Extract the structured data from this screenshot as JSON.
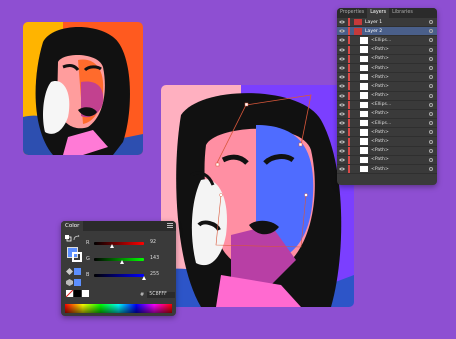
{
  "layers_panel": {
    "tabs": [
      "Properties",
      "Layers",
      "Libraries"
    ],
    "active_tab": "Layers",
    "layers": [
      {
        "name": "Layer 1",
        "kind": "layer",
        "expanded": false
      },
      {
        "name": "Layer 2",
        "kind": "layer",
        "expanded": true,
        "selected": true
      }
    ],
    "items": [
      {
        "name": "<Ellips..."
      },
      {
        "name": "<Path>"
      },
      {
        "name": "<Path>"
      },
      {
        "name": "<Path>"
      },
      {
        "name": "<Path>"
      },
      {
        "name": "<Path>"
      },
      {
        "name": "<Path>"
      },
      {
        "name": "<Ellips..."
      },
      {
        "name": "<Path>"
      },
      {
        "name": "<Ellips..."
      },
      {
        "name": "<Path>"
      },
      {
        "name": "<Path>"
      },
      {
        "name": "<Path>"
      },
      {
        "name": "<Path>"
      },
      {
        "name": "<Path>"
      }
    ]
  },
  "color_panel": {
    "tab": "Color",
    "channels": [
      {
        "label": "R",
        "value": "92",
        "level": 0.36,
        "gradient": [
          "#000000",
          "#ff0000"
        ]
      },
      {
        "label": "G",
        "value": "143",
        "level": 0.56,
        "gradient": [
          "#000000",
          "#00ff00"
        ]
      },
      {
        "label": "B",
        "value": "255",
        "level": 1.0,
        "gradient": [
          "#000000",
          "#0000ff"
        ]
      }
    ],
    "hash_label": "#",
    "hex": "5C8FFF",
    "fill_color": "#5c8fff",
    "stroke_color": "#ffffff"
  },
  "colors": {
    "background": "#8e4fd2",
    "panel": "#3a3a3a",
    "layer_bar": "#d94a48",
    "selection": "#4a5f8a"
  }
}
